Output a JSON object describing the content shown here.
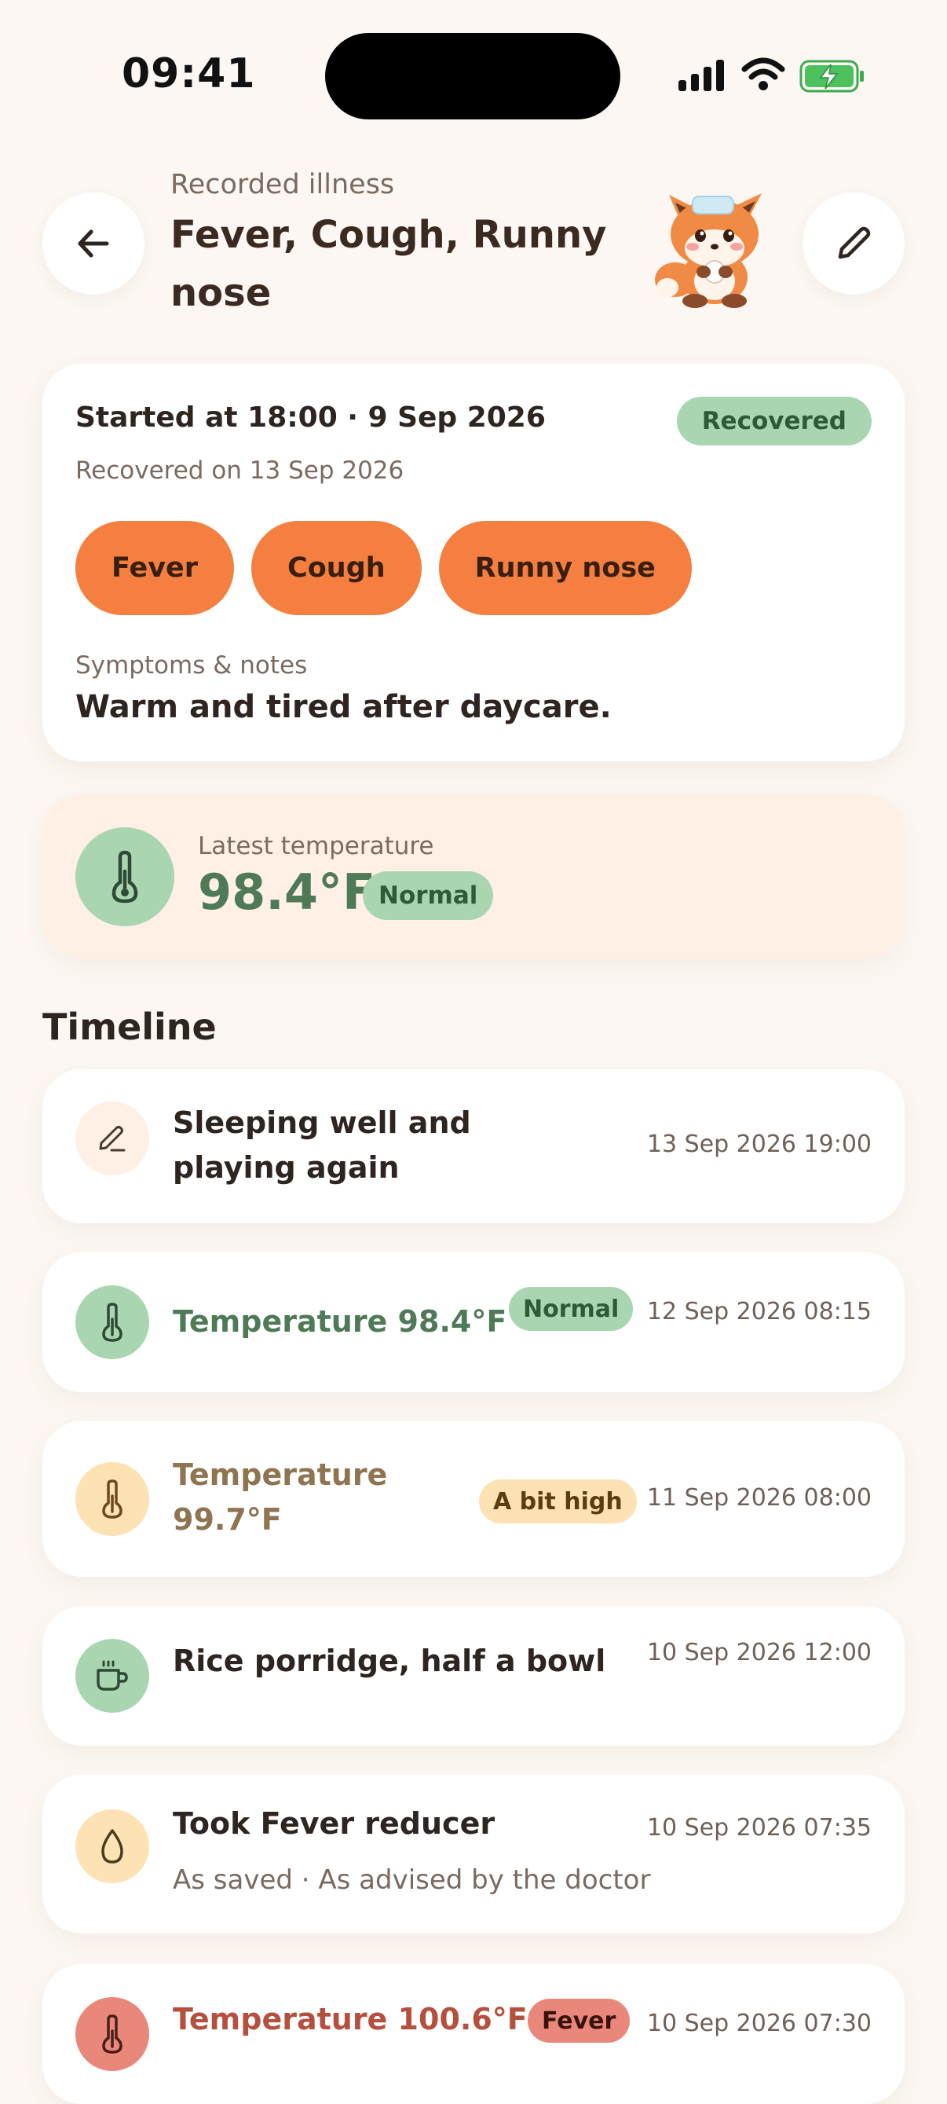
{
  "status_bar": {
    "time": "09:41"
  },
  "header": {
    "subtitle": "Recorded illness",
    "title": "Fever, Cough, Runny nose"
  },
  "summary": {
    "started": "Started at 18:00 · 9 Sep 2026",
    "status": "Recovered",
    "recovered_on": "Recovered on 13 Sep 2026",
    "symptoms": [
      "Fever",
      "Cough",
      "Runny nose"
    ],
    "notes_label": "Symptoms & notes",
    "notes": "Warm and tired after daycare."
  },
  "latest_temperature": {
    "label": "Latest temperature",
    "value": "98.4°F",
    "status": "Normal"
  },
  "timeline": {
    "title": "Timeline",
    "items": [
      {
        "type": "note",
        "icon": "pencil-icon",
        "title": "Sleeping well and playing again",
        "time": "13 Sep 2026 19:00"
      },
      {
        "type": "temperature",
        "icon": "thermometer-icon",
        "title": "Temperature 98.4°F",
        "badge": "Normal",
        "time": "12 Sep 2026 08:15"
      },
      {
        "type": "temperature",
        "icon": "thermometer-icon",
        "title": "Temperature 99.7°F",
        "badge": "A bit high",
        "time": "11 Sep 2026 08:00"
      },
      {
        "type": "meal",
        "icon": "cup-icon",
        "title": "Rice porridge, half a bowl",
        "time": "10 Sep 2026 12:00"
      },
      {
        "type": "medicine",
        "icon": "drop-icon",
        "title": "Took Fever reducer",
        "subtitle": "As saved · As advised by the doctor",
        "time": "10 Sep 2026 07:35"
      },
      {
        "type": "temperature",
        "icon": "thermometer-icon",
        "title": "Temperature 100.6°F",
        "badge": "Fever",
        "time": "10 Sep 2026 07:30"
      }
    ]
  },
  "colors": {
    "background": "#FCF7F2",
    "accent_orange": "#F47F40",
    "normal_green": "#A9D6B1",
    "high_yellow": "#FDE2B4",
    "fever_red": "#E9877A"
  }
}
